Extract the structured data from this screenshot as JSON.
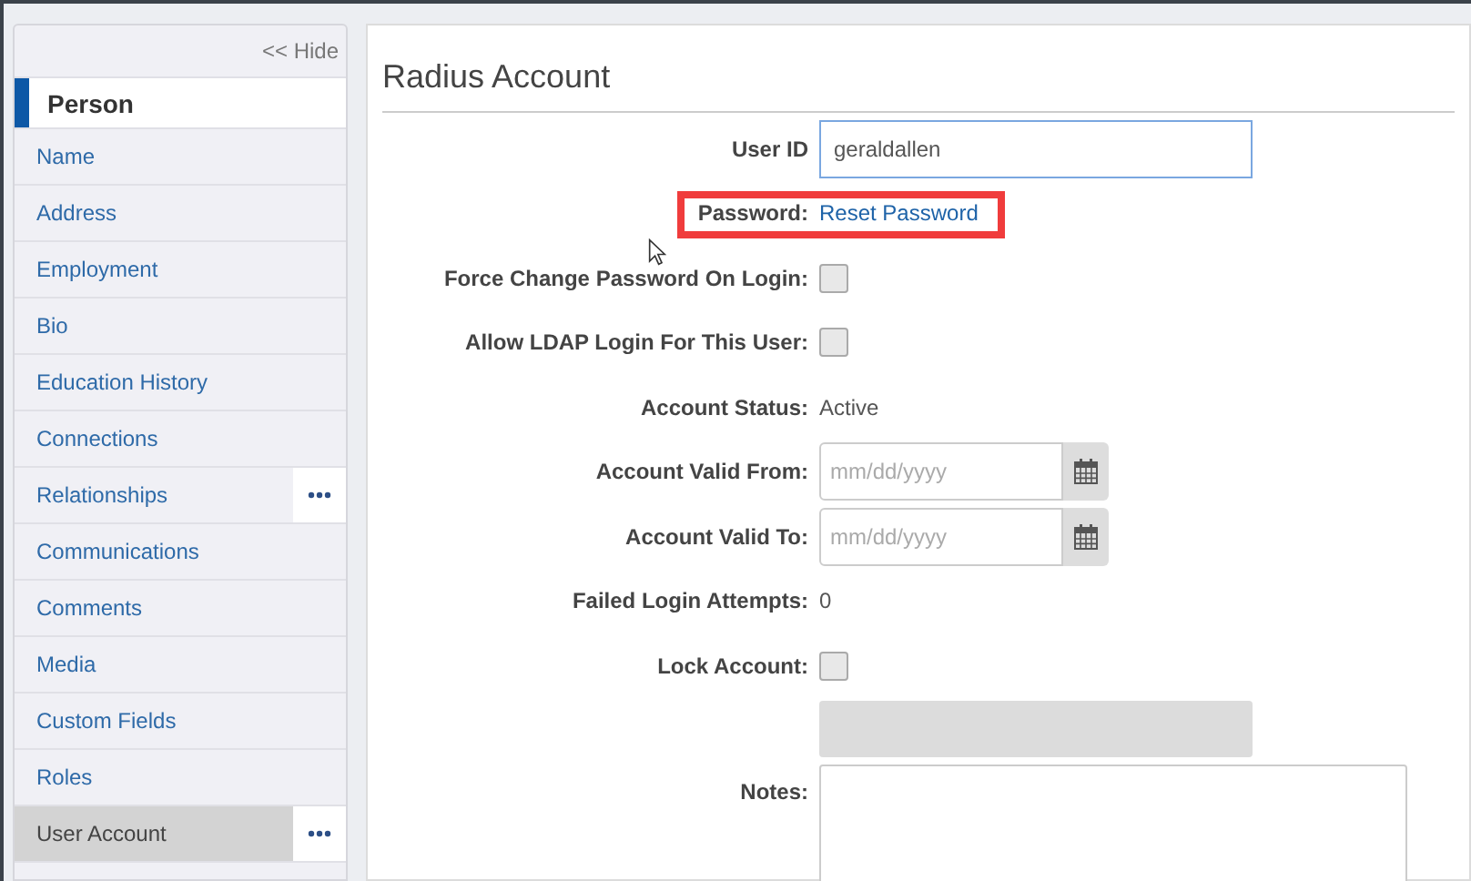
{
  "sidebar": {
    "hide_link": "<< Hide",
    "header": "Person",
    "items": [
      {
        "label": "Name",
        "selected": false,
        "has_menu": false
      },
      {
        "label": "Address",
        "selected": false,
        "has_menu": false
      },
      {
        "label": "Employment",
        "selected": false,
        "has_menu": false
      },
      {
        "label": "Bio",
        "selected": false,
        "has_menu": false
      },
      {
        "label": "Education History",
        "selected": false,
        "has_menu": false
      },
      {
        "label": "Connections",
        "selected": false,
        "has_menu": false
      },
      {
        "label": "Relationships",
        "selected": false,
        "has_menu": true
      },
      {
        "label": "Communications",
        "selected": false,
        "has_menu": false
      },
      {
        "label": "Comments",
        "selected": false,
        "has_menu": false
      },
      {
        "label": "Media",
        "selected": false,
        "has_menu": false
      },
      {
        "label": "Custom Fields",
        "selected": false,
        "has_menu": false
      },
      {
        "label": "Roles",
        "selected": false,
        "has_menu": false
      },
      {
        "label": "User Account",
        "selected": true,
        "has_menu": true
      }
    ]
  },
  "form": {
    "title": "Radius Account",
    "rows": [
      {
        "kind": "input",
        "label": "User ID",
        "value": "geraldallen",
        "highlighted": false
      },
      {
        "kind": "link",
        "label": "Password:",
        "value": "Reset Password",
        "highlighted": true
      },
      {
        "kind": "checkbox",
        "label": "Force Change Password On Login:",
        "checked": false,
        "highlighted": false
      },
      {
        "kind": "checkbox",
        "label": "Allow LDAP Login For This User:",
        "checked": false,
        "highlighted": false
      },
      {
        "kind": "text",
        "label": "Account Status:",
        "value": "Active",
        "highlighted": false
      },
      {
        "kind": "date",
        "label": "Account Valid From:",
        "placeholder": "mm/dd/yyyy",
        "highlighted": false
      },
      {
        "kind": "date",
        "label": "Account Valid To:",
        "placeholder": "mm/dd/yyyy",
        "highlighted": false
      },
      {
        "kind": "text",
        "label": "Failed Login Attempts:",
        "value": "0",
        "highlighted": false
      },
      {
        "kind": "checkbox",
        "label": "Lock Account:",
        "checked": false,
        "highlighted": false
      },
      {
        "kind": "bar",
        "highlighted": false
      },
      {
        "kind": "textarea",
        "label": "Notes:",
        "highlighted": false
      }
    ]
  }
}
